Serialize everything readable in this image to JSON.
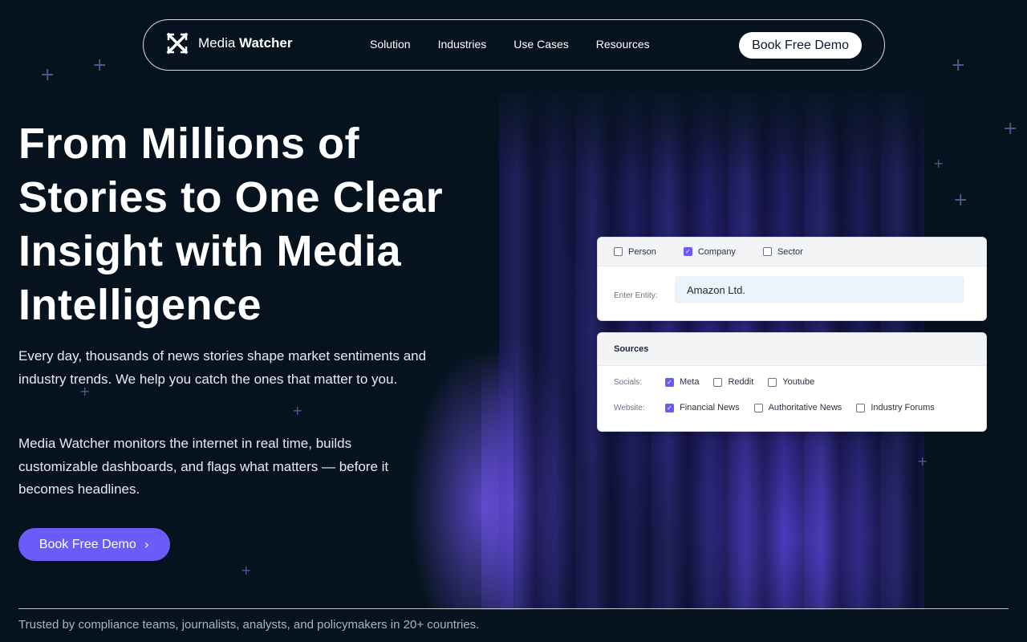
{
  "nav": {
    "brand_light": "Media",
    "brand_bold": "Watcher",
    "links": [
      "Solution",
      "Industries",
      "Use Cases",
      "Resources"
    ],
    "cta": "Book Free Demo"
  },
  "hero": {
    "title": "From Millions of Stories to One Clear Insight with Media Intelligence",
    "paragraph1": "Every day, thousands of news stories shape market sentiments and industry trends. We help you catch the ones that matter to you.",
    "paragraph2": "Media Watcher monitors the internet in real time, builds customizable dashboards, and flags what matters — before it becomes headlines.",
    "cta": "Book Free Demo"
  },
  "entity_card": {
    "types": [
      {
        "label": "Person",
        "checked": false
      },
      {
        "label": "Company",
        "checked": true
      },
      {
        "label": "Sector",
        "checked": false
      }
    ],
    "entity_label": "Enter Entity:",
    "entity_value": "Amazon Ltd."
  },
  "sources_card": {
    "title": "Sources",
    "socials_label": "Socials:",
    "socials": [
      {
        "label": "Meta",
        "checked": true
      },
      {
        "label": "Reddit",
        "checked": false
      },
      {
        "label": "Youtube",
        "checked": false
      }
    ],
    "website_label": "Website:",
    "websites": [
      {
        "label": "Financial News",
        "checked": true
      },
      {
        "label": "Authoritative News",
        "checked": false
      },
      {
        "label": "Industry Forums",
        "checked": false
      }
    ]
  },
  "footer": {
    "trusted": "Trusted by compliance teams, journalists, analysts, and policymakers in 20+ countries."
  },
  "colors": {
    "background": "#06131e",
    "accent": "#6a5cf8"
  }
}
